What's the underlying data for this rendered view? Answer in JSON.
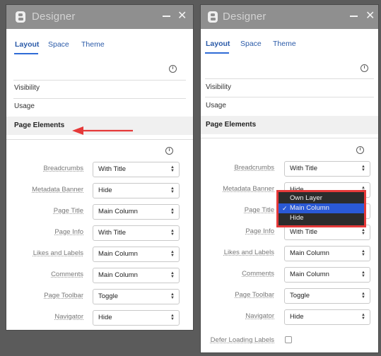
{
  "panels": [
    {
      "id": "left",
      "title": "Designer",
      "tabs": [
        {
          "label": "Layout",
          "active": true
        },
        {
          "label": "Space",
          "active": false
        },
        {
          "label": "Theme",
          "active": false
        }
      ],
      "sections": [
        "Visibility",
        "Usage",
        "Page Elements"
      ],
      "active_section": "Page Elements",
      "rows": [
        {
          "label": "Breadcrumbs",
          "value": "With Title"
        },
        {
          "label": "Metadata Banner",
          "value": "Hide"
        },
        {
          "label": "Page Title",
          "value": "Main Column"
        },
        {
          "label": "Page Info",
          "value": "With Title"
        },
        {
          "label": "Likes and Labels",
          "value": "Main Column"
        },
        {
          "label": "Comments",
          "value": "Main Column"
        },
        {
          "label": "Page Toolbar",
          "value": "Toggle"
        },
        {
          "label": "Navigator",
          "value": "Hide"
        }
      ]
    },
    {
      "id": "right",
      "title": "Designer",
      "tabs": [
        {
          "label": "Layout",
          "active": true
        },
        {
          "label": "Space",
          "active": false
        },
        {
          "label": "Theme",
          "active": false
        }
      ],
      "sections": [
        "Visibility",
        "Usage",
        "Page Elements"
      ],
      "active_section": "Page Elements",
      "rows": [
        {
          "label": "Breadcrumbs",
          "value": "With Title"
        },
        {
          "label": "Metadata Banner",
          "value": "Hide"
        },
        {
          "label": "Page Title",
          "value": "Main Column"
        },
        {
          "label": "Page Info",
          "value": "With Title"
        },
        {
          "label": "Likes and Labels",
          "value": "Main Column"
        },
        {
          "label": "Comments",
          "value": "Main Column"
        },
        {
          "label": "Page Toolbar",
          "value": "Toggle"
        },
        {
          "label": "Navigator",
          "value": "Hide"
        }
      ],
      "extra_checkbox": {
        "label": "Defer Loading Labels",
        "checked": false
      },
      "open_dropdown": {
        "field": "Page Title",
        "options": [
          "Own Layer",
          "Main Column",
          "Hide"
        ],
        "selected": "Main Column"
      }
    }
  ],
  "colors": {
    "titlebar": "#8f8f8f",
    "tab_text": "#2a5aa8",
    "highlight_red": "#e53939",
    "dropdown_selected": "#2a59d6"
  },
  "icons": {
    "logo": "b-logo-icon",
    "info": "info-icon",
    "minimize": "minimize-icon",
    "close": "close-icon",
    "select_caret": "updown-caret-icon",
    "pointer": "left-arrow-icon"
  }
}
